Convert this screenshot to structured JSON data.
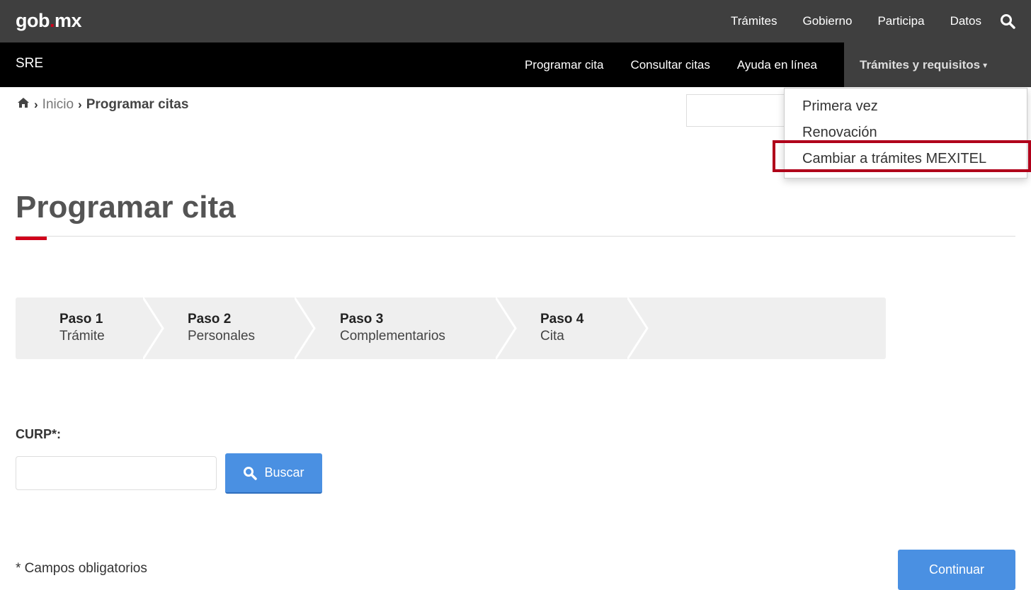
{
  "topbar": {
    "logo_part1": "gob",
    "logo_dot": ".",
    "logo_part2": "mx",
    "links": [
      "Trámites",
      "Gobierno",
      "Participa",
      "Datos"
    ],
    "search_icon": "search-icon"
  },
  "sre": {
    "title": "SRE",
    "links": [
      "Programar cita",
      "Consultar citas",
      "Ayuda en línea"
    ],
    "active": "Trámites y requisitos",
    "caret": "▾"
  },
  "breadcrumb": {
    "home_icon": "home-icon",
    "sep": "›",
    "items": [
      "Inicio",
      "Programar citas"
    ]
  },
  "dropdown": {
    "items": [
      "Primera vez",
      "Renovación",
      "Cambiar a trámites MEXITEL"
    ]
  },
  "page": {
    "title": "Programar cita"
  },
  "steps": [
    {
      "num": "Paso 1",
      "name": "Trámite"
    },
    {
      "num": "Paso 2",
      "name": "Personales"
    },
    {
      "num": "Paso 3",
      "name": "Complementarios"
    },
    {
      "num": "Paso 4",
      "name": "Cita"
    }
  ],
  "form": {
    "curp_label": "CURP*:",
    "curp_value": "",
    "search_button": "Buscar",
    "required_note": "* Campos obligatorios",
    "continue_button": "Continuar"
  },
  "colors": {
    "topbar": "#3f3f3f",
    "srebar": "#000000",
    "accent_red": "#d0021b",
    "button_blue": "#4a90e2",
    "highlight": "#b0001a"
  }
}
